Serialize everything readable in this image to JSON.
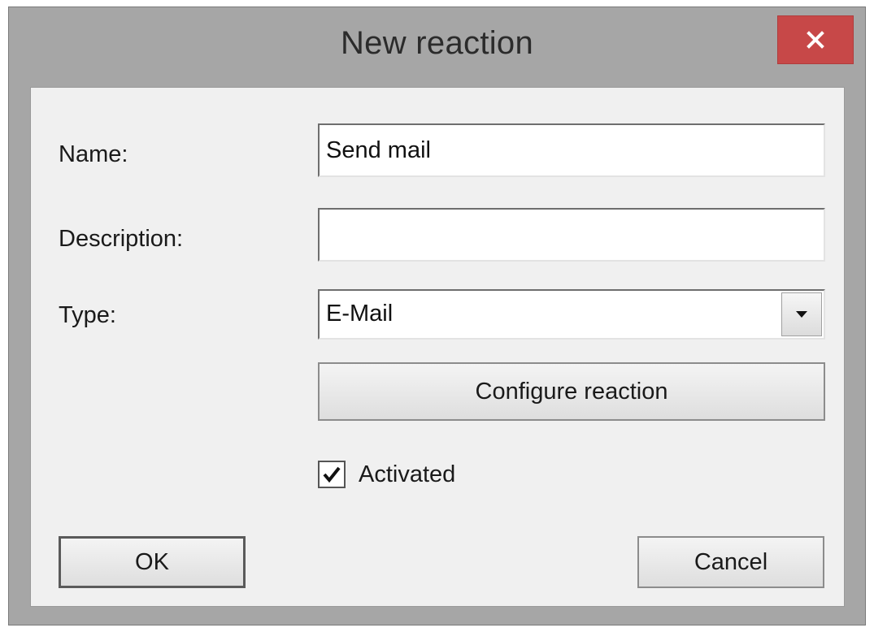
{
  "dialog": {
    "title": "New reaction",
    "close_icon": "close-icon"
  },
  "form": {
    "name_label": "Name:",
    "name_value": "Send mail",
    "description_label": "Description:",
    "description_value": "",
    "type_label": "Type:",
    "type_value": "E-Mail",
    "type_arrow_icon": "dropdown-arrow-icon",
    "configure_label": "Configure reaction",
    "activated_label": "Activated",
    "activated_checked": true
  },
  "buttons": {
    "ok_label": "OK",
    "cancel_label": "Cancel"
  },
  "colors": {
    "close_button": "#c74848",
    "frame": "#a6a6a6",
    "client": "#f0f0f0"
  }
}
